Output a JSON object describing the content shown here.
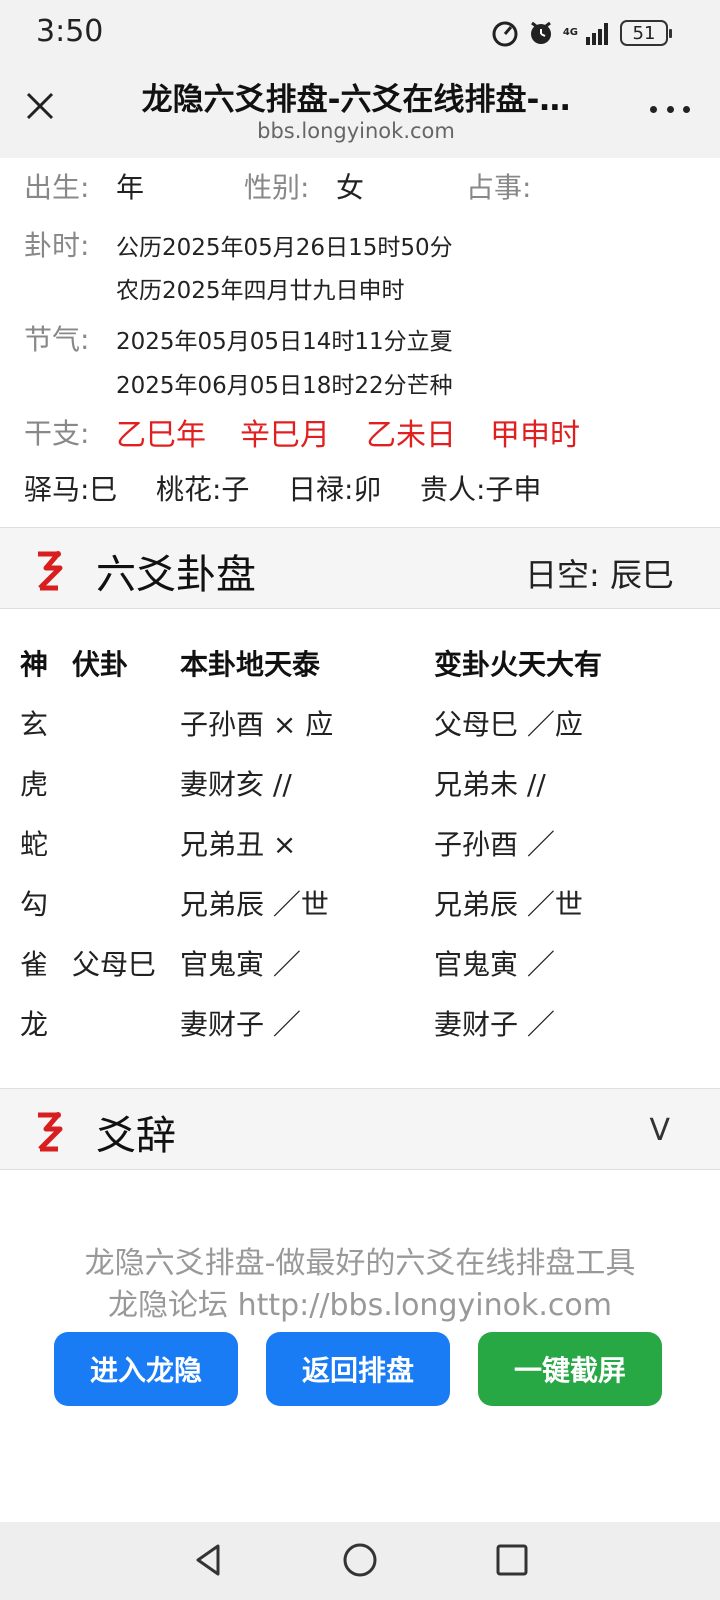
{
  "status": {
    "time": "3:50",
    "network": "4G",
    "battery": "51"
  },
  "browser": {
    "title": "龙隐六爻排盘-六爻在线排盘-…",
    "url": "bbs.longyinok.com"
  },
  "info": {
    "birth_label": "出生:",
    "birth_value": "年",
    "gender_label": "性别:",
    "gender_value": "女",
    "matter_label": "占事:",
    "time_label": "卦时:",
    "solar": "公历2025年05月26日15时50分",
    "lunar": "农历2025年四月廿九日申时",
    "term_label": "节气:",
    "term1": "2025年05月05日14时11分立夏",
    "term2": "2025年06月05日18时22分芒种",
    "ganzhi_label": "干支:",
    "ganzhi": [
      "乙巳年",
      "辛巳月",
      "乙未日",
      "甲申时"
    ],
    "shensha": [
      "驿马:巳",
      "桃花:子",
      "日禄:卯",
      "贵人:子申"
    ]
  },
  "liuyao_section": {
    "title": "六爻卦盘",
    "void_label": "日空:",
    "void_value": "辰巳"
  },
  "gua_table": {
    "headers": {
      "shen": "神",
      "fu": "伏卦",
      "ben": "本卦地天泰",
      "bian": "变卦火天大有"
    },
    "rows": [
      {
        "shen": "玄",
        "fu": "",
        "ben": "子孙酉 × 应",
        "bian": "父母巳 ／应"
      },
      {
        "shen": "虎",
        "fu": "",
        "ben": "妻财亥 //",
        "bian": "兄弟未 //"
      },
      {
        "shen": "蛇",
        "fu": "",
        "ben": "兄弟丑 ×",
        "bian": "子孙酉 ／"
      },
      {
        "shen": "勾",
        "fu": "",
        "ben": "兄弟辰 ／世",
        "bian": "兄弟辰 ／世"
      },
      {
        "shen": "雀",
        "fu": "父母巳",
        "ben": "官鬼寅 ／",
        "bian": "官鬼寅 ／"
      },
      {
        "shen": "龙",
        "fu": "",
        "ben": "妻财子 ／",
        "bian": "妻财子 ／"
      }
    ]
  },
  "yaoci_section": {
    "title": "爻辞",
    "toggle": "V"
  },
  "footer": {
    "line1": "龙隐六爻排盘-做最好的六爻在线排盘工具",
    "line2": "龙隐论坛 http://bbs.longyinok.com",
    "buttons": [
      "进入龙隐",
      "返回排盘",
      "一键截屏"
    ]
  }
}
